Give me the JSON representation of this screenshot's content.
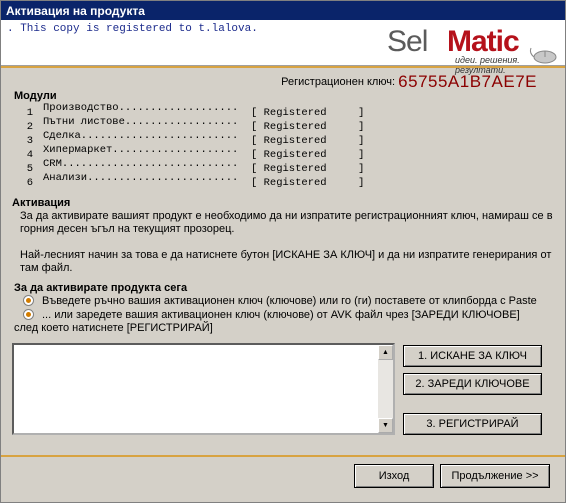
{
  "window": {
    "title": "Активация на продукта"
  },
  "banner": {
    "registered_text": ". This copy is registered to  t.lalova."
  },
  "logo": {
    "sel": "Sel",
    "matic": "Matic",
    "tagline": "идеи. решения. резултати."
  },
  "registration": {
    "label": "Регистрационен ключ:",
    "key": "65755A1B7AE7E"
  },
  "modules": {
    "title": "Модули",
    "items": [
      {
        "num": "1",
        "name": "Производство...................",
        "status": "[ Registered     ]"
      },
      {
        "num": "2",
        "name": "Пътни листове..................",
        "status": "[ Registered     ]"
      },
      {
        "num": "3",
        "name": "Сделка.........................",
        "status": "[ Registered     ]"
      },
      {
        "num": "4",
        "name": "Хипермаркет....................",
        "status": "[ Registered     ]"
      },
      {
        "num": "5",
        "name": "CRM............................",
        "status": "[ Registered     ]"
      },
      {
        "num": "6",
        "name": "Анализи........................",
        "status": "[ Registered     ]"
      }
    ]
  },
  "activation": {
    "title": "Активация",
    "paragraph1": "За да активирате вашият продукт е необходимо да ни изпратите регистрационният ключ, намираш се в горния десен ъгъл на текущият прозорец.",
    "paragraph2": "Най-лесният начин за това е да натиснете бутон [ИСКАНЕ ЗА КЛЮЧ] и да ни изпратите генерирания от там файл."
  },
  "activate_now": {
    "title": "За да активирате продукта сега",
    "option1": "Въведете ръчно вашия активационен ключ (ключове) или го (ги) поставете от клипборда с Paste",
    "option2": "... или заредете вашия активационен ключ (ключове) от AVK файл чрез [ЗАРЕДИ КЛЮЧОВЕ]",
    "option2_cont": "след което натиснете [РЕГИСТРИРАЙ]"
  },
  "key_input": {
    "value": ""
  },
  "buttons": {
    "request_key": "1. ИСКАНЕ ЗА КЛЮЧ",
    "load_keys": "2. ЗАРЕДИ КЛЮЧОВЕ",
    "register": "3. РЕГИСТРИРАЙ",
    "exit": "Изход",
    "continue": "Продължение >>"
  },
  "colors": {
    "accent_line": "#d8a341",
    "title_bar": "#0a246a",
    "key_color": "#8b0000",
    "brand_red": "#b5121b"
  }
}
